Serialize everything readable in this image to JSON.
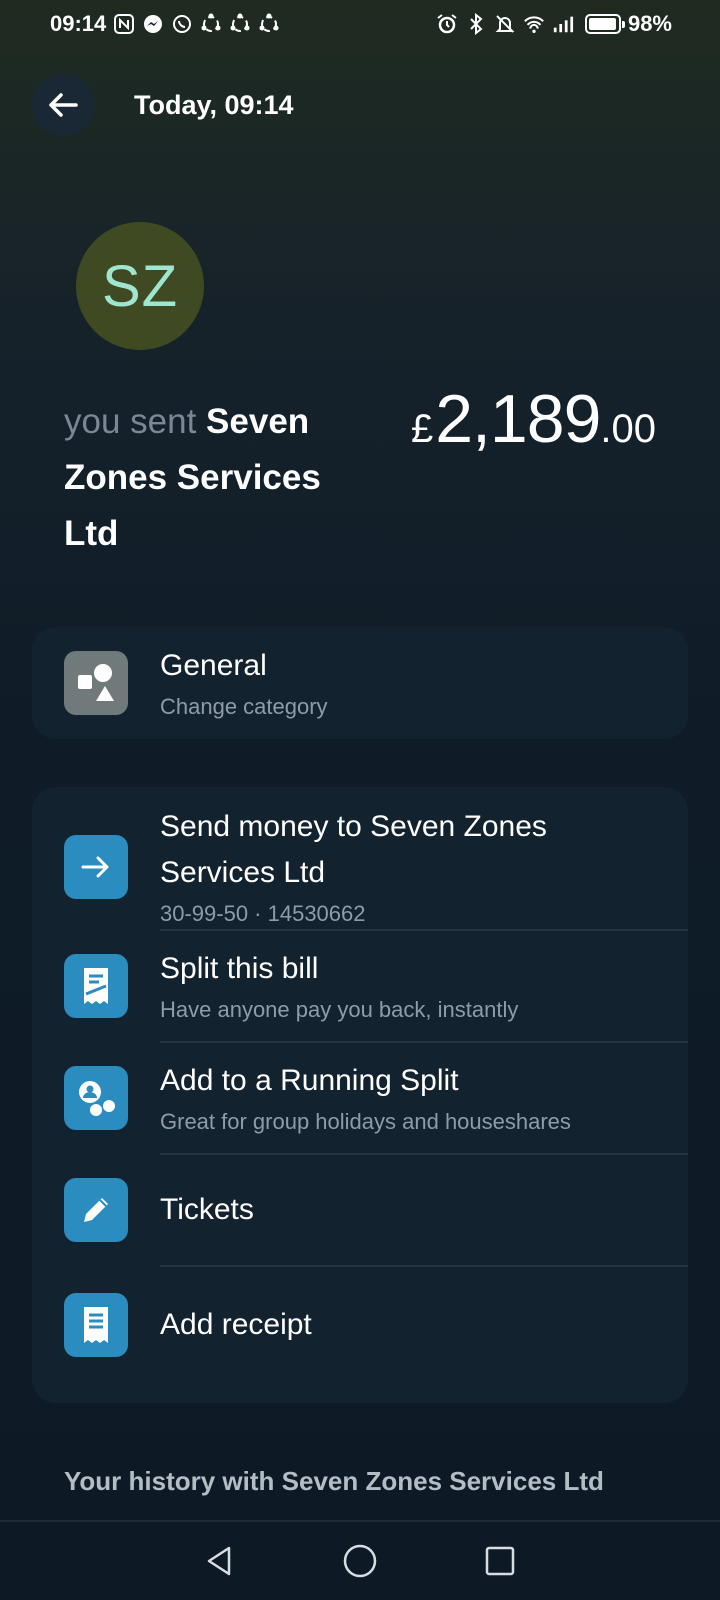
{
  "status_bar": {
    "time": "09:14",
    "battery": "98%",
    "left_icons": [
      "nfc-icon",
      "messenger-icon",
      "whatsapp-icon",
      "sync-icon",
      "sync-icon",
      "sync-icon"
    ],
    "right_icons": [
      "alarm-icon",
      "bluetooth-icon",
      "mute-icon",
      "wifi-icon",
      "signal-icon",
      "battery-icon"
    ]
  },
  "header": {
    "title": "Today, 09:14"
  },
  "payee": {
    "initials": "SZ",
    "avatar_bg": "#3f4a22",
    "avatar_fg": "#9ee6cf",
    "sent_prefix": "you sent",
    "name": "Seven Zones Services Ltd"
  },
  "amount": {
    "currency": "£",
    "main": "2,189",
    "decimal": ".00"
  },
  "category": {
    "title": "General",
    "subtitle": "Change category"
  },
  "actions": [
    {
      "title": "Send money to Seven Zones Services Ltd",
      "subtitle": "30-99-50 · 14530662",
      "icon": "arrow-right-icon"
    },
    {
      "title": "Split this bill",
      "subtitle": "Have anyone pay you back, instantly",
      "icon": "split-bill-icon"
    },
    {
      "title": "Add to a Running Split",
      "subtitle": "Great for group holidays and houseshares",
      "icon": "running-split-icon"
    },
    {
      "title": "Tickets",
      "subtitle": "",
      "icon": "pencil-icon"
    },
    {
      "title": "Add receipt",
      "subtitle": "",
      "icon": "receipt-icon"
    }
  ],
  "history": {
    "title": "Your history with Seven Zones Services Ltd"
  },
  "colors": {
    "accent_blue": "#2a8cbf",
    "card_bg": "#13222f",
    "category_tile": "#717a7a"
  }
}
